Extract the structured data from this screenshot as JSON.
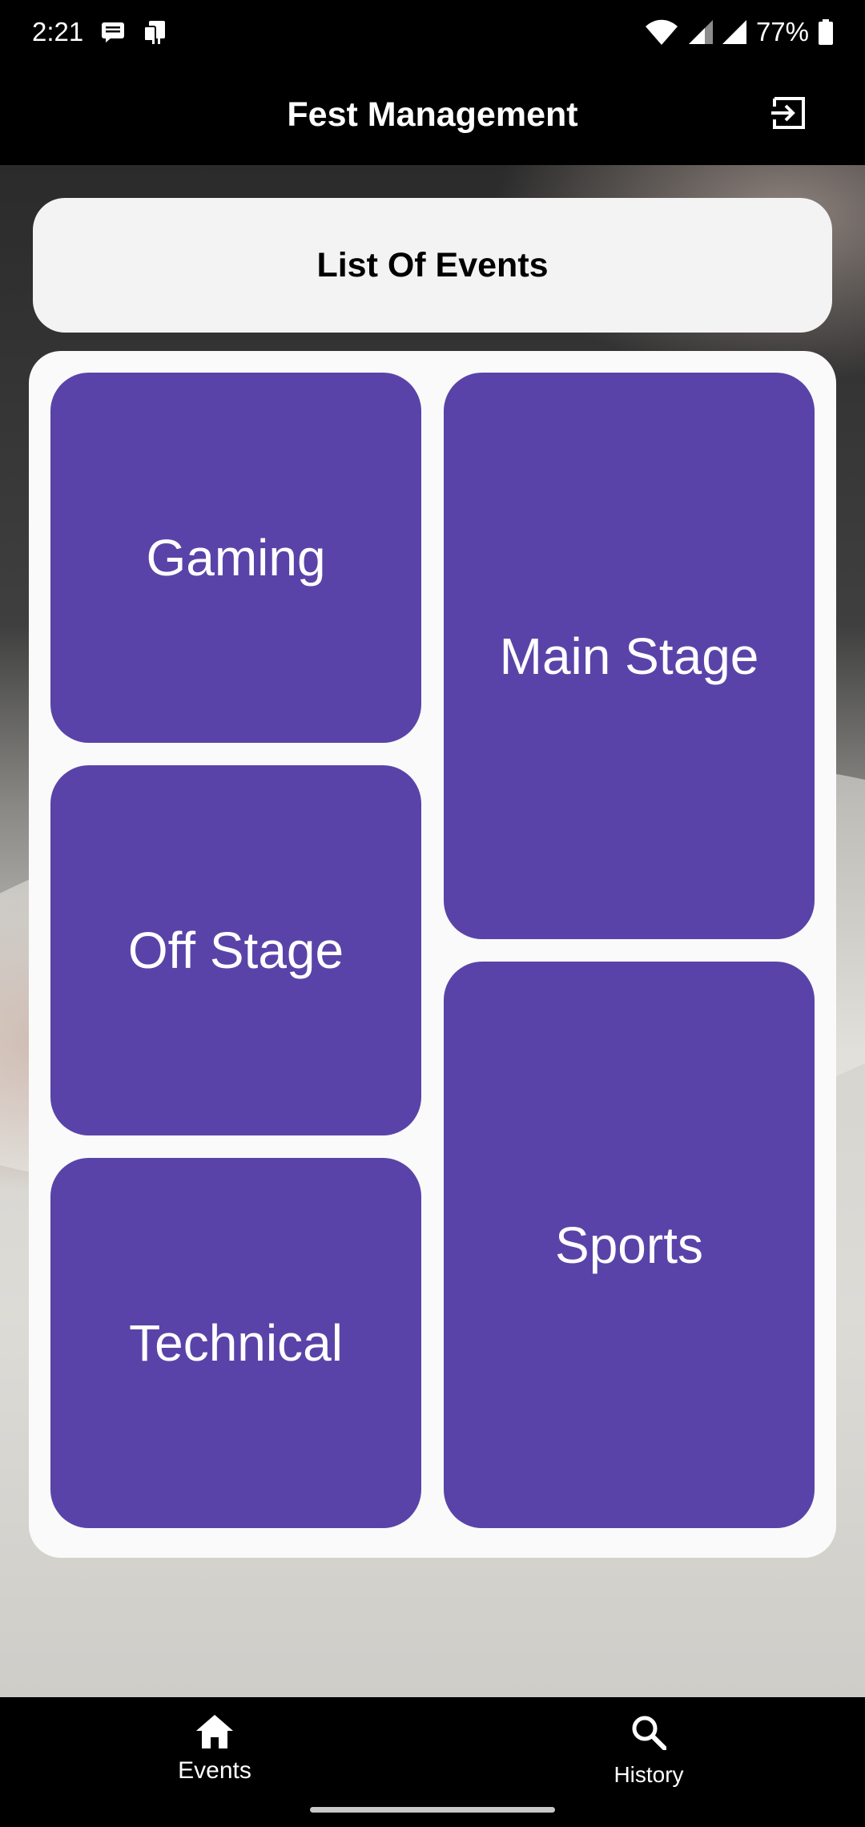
{
  "status_bar": {
    "time": "2:21",
    "battery_percent": "77%",
    "icons": [
      "message-notification-icon",
      "sim-notification-icon",
      "wifi-icon",
      "signal-icon",
      "signal-icon",
      "battery-icon"
    ]
  },
  "app_bar": {
    "title": "Fest Management",
    "logout_icon": "logout-icon"
  },
  "list_header": {
    "title": "List Of Events"
  },
  "events": {
    "gaming": "Gaming",
    "main_stage": "Main Stage",
    "off_stage": "Off Stage",
    "sports": "Sports",
    "technical": "Technical"
  },
  "bottom_nav": {
    "items": [
      {
        "label": "Events",
        "icon": "home-icon",
        "active": true
      },
      {
        "label": "History",
        "icon": "search-icon",
        "active": false
      }
    ]
  },
  "colors": {
    "tile": "#5a43a8",
    "bar": "#000000",
    "panel": "#fafafa",
    "header_card": "#f3f3f3"
  }
}
